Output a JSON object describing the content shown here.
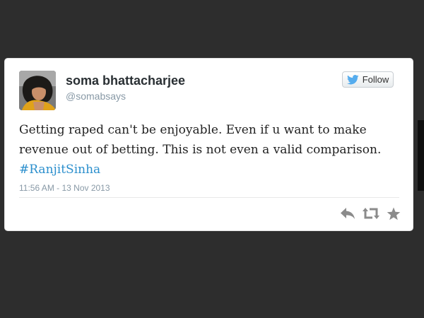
{
  "tweet": {
    "author": {
      "display_name": "soma bhattacharjee",
      "handle": "@somabsays"
    },
    "follow_button": {
      "label": "Follow"
    },
    "text": {
      "body": "Getting raped can't be enjoyable. Even if u want to make revenue out of betting. This is not even a valid comparison.",
      "hashtag": "#RanjitSinha"
    },
    "timestamp": "11:56 AM - 13 Nov 2013",
    "actions": {
      "reply_icon": "reply-icon",
      "retweet_icon": "retweet-icon",
      "favorite_icon": "star-icon"
    }
  },
  "colors": {
    "background": "#2d2d2d",
    "card": "#ffffff",
    "hashtag": "#2b8fcd",
    "twitter_blue": "#55acee",
    "action_gray": "#8b8b8b"
  }
}
